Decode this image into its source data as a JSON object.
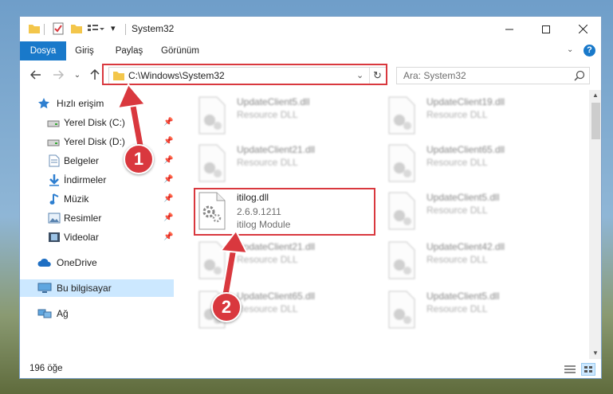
{
  "window": {
    "title": "System32"
  },
  "ribbon": {
    "tabs": [
      {
        "label": "Dosya"
      },
      {
        "label": "Giriş"
      },
      {
        "label": "Paylaş"
      },
      {
        "label": "Görünüm"
      }
    ]
  },
  "navbar": {
    "address": "C:\\Windows\\System32",
    "search_placeholder": "Ara: System32"
  },
  "sidebar": {
    "items": [
      {
        "label": "Hızlı erişim"
      },
      {
        "label": "Yerel Disk (C:)"
      },
      {
        "label": "Yerel Disk (D:)"
      },
      {
        "label": "Belgeler"
      },
      {
        "label": "İndirmeler"
      },
      {
        "label": "Müzik"
      },
      {
        "label": "Resimler"
      },
      {
        "label": "Videolar"
      },
      {
        "label": "OneDrive"
      },
      {
        "label": "Bu bilgisayar"
      },
      {
        "label": "Ağ"
      }
    ]
  },
  "files": [
    {
      "name": "UpdateClient5.dll",
      "desc": "Resource DLL"
    },
    {
      "name": "UpdateClient19.dll",
      "desc": "Resource DLL"
    },
    {
      "name": "UpdateClient21.dll",
      "desc": "Resource DLL"
    },
    {
      "name": "UpdateClient65.dll",
      "desc": "Resource DLL"
    },
    {
      "name": "itilog.dll",
      "version": "2.6.9.1211",
      "desc": "itilog Module"
    },
    {
      "name": "UpdateClient5.dll",
      "desc": "Resource DLL"
    },
    {
      "name": "UpdateClient21.dll",
      "desc": "Resource DLL"
    },
    {
      "name": "UpdateClient42.dll",
      "desc": "Resource DLL"
    },
    {
      "name": "UpdateClient65.dll",
      "desc": "Resource DLL"
    },
    {
      "name": "UpdateClient5.dll",
      "desc": "Resource DLL"
    }
  ],
  "status": {
    "item_count": "196 öğe"
  },
  "annotations": {
    "step1": "1",
    "step2": "2"
  },
  "colors": {
    "accent": "#1979ca",
    "highlight": "#d9383e",
    "selection": "#cce8ff"
  }
}
